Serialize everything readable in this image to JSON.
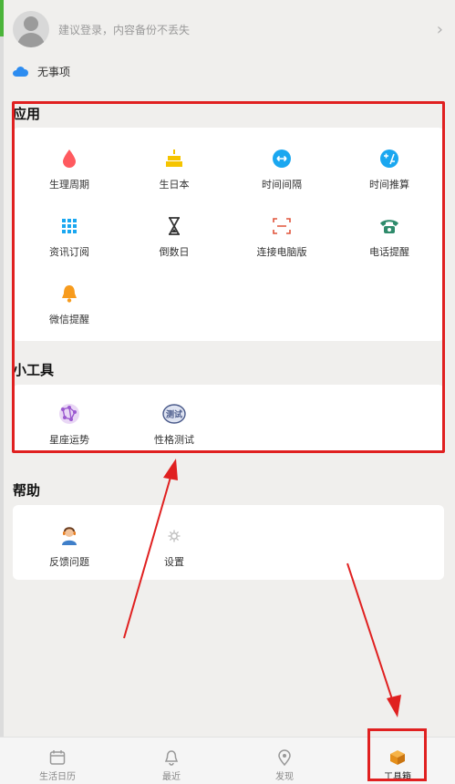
{
  "account": {
    "login_prompt": "建议登录，内容备份不丢失",
    "chevron": "›"
  },
  "status": {
    "text": "无事项",
    "icon": "cloud-icon",
    "color": "#2d8cf0"
  },
  "apps": {
    "title": "应用",
    "items": [
      {
        "label": "生理周期",
        "icon": "droplet-icon",
        "color": "#ff5a5f"
      },
      {
        "label": "生日本",
        "icon": "cake-icon",
        "color": "#f5c400"
      },
      {
        "label": "时间间隔",
        "icon": "interval-icon",
        "color": "#1aa7f0"
      },
      {
        "label": "时间推算",
        "icon": "calculator-icon",
        "color": "#1aa7f0"
      },
      {
        "label": "资讯订阅",
        "icon": "grid-icon",
        "color": "#1aa7f0"
      },
      {
        "label": "倒数日",
        "icon": "hourglass-icon",
        "color": "#333333"
      },
      {
        "label": "连接电脑版",
        "icon": "scan-icon",
        "color": "#e0533a"
      },
      {
        "label": "电话提醒",
        "icon": "phone-icon",
        "color": "#2e8b6b"
      },
      {
        "label": "微信提醒",
        "icon": "bell-icon",
        "color": "#f79b1d"
      }
    ]
  },
  "tools": {
    "title": "小工具",
    "items": [
      {
        "label": "星座运势",
        "icon": "constellation-icon",
        "color": "#9b59d0"
      },
      {
        "label": "性格测试",
        "icon": "personality-test-icon",
        "color": "#4a5a8a",
        "badge_text": "测试"
      }
    ]
  },
  "help": {
    "title": "帮助",
    "items": [
      {
        "label": "反馈问题",
        "icon": "support-agent-icon",
        "color": "#e67e22"
      },
      {
        "label": "设置",
        "icon": "gear-icon",
        "color": "#bbbbbb"
      }
    ]
  },
  "tabbar": {
    "items": [
      {
        "label": "生活日历",
        "icon": "calendar-icon",
        "active": false
      },
      {
        "label": "最近",
        "icon": "bell-icon",
        "active": false
      },
      {
        "label": "发现",
        "icon": "location-pin-icon",
        "active": false
      },
      {
        "label": "工具箱",
        "icon": "box-icon",
        "active": true
      }
    ]
  },
  "annotation_color": "#e02020"
}
